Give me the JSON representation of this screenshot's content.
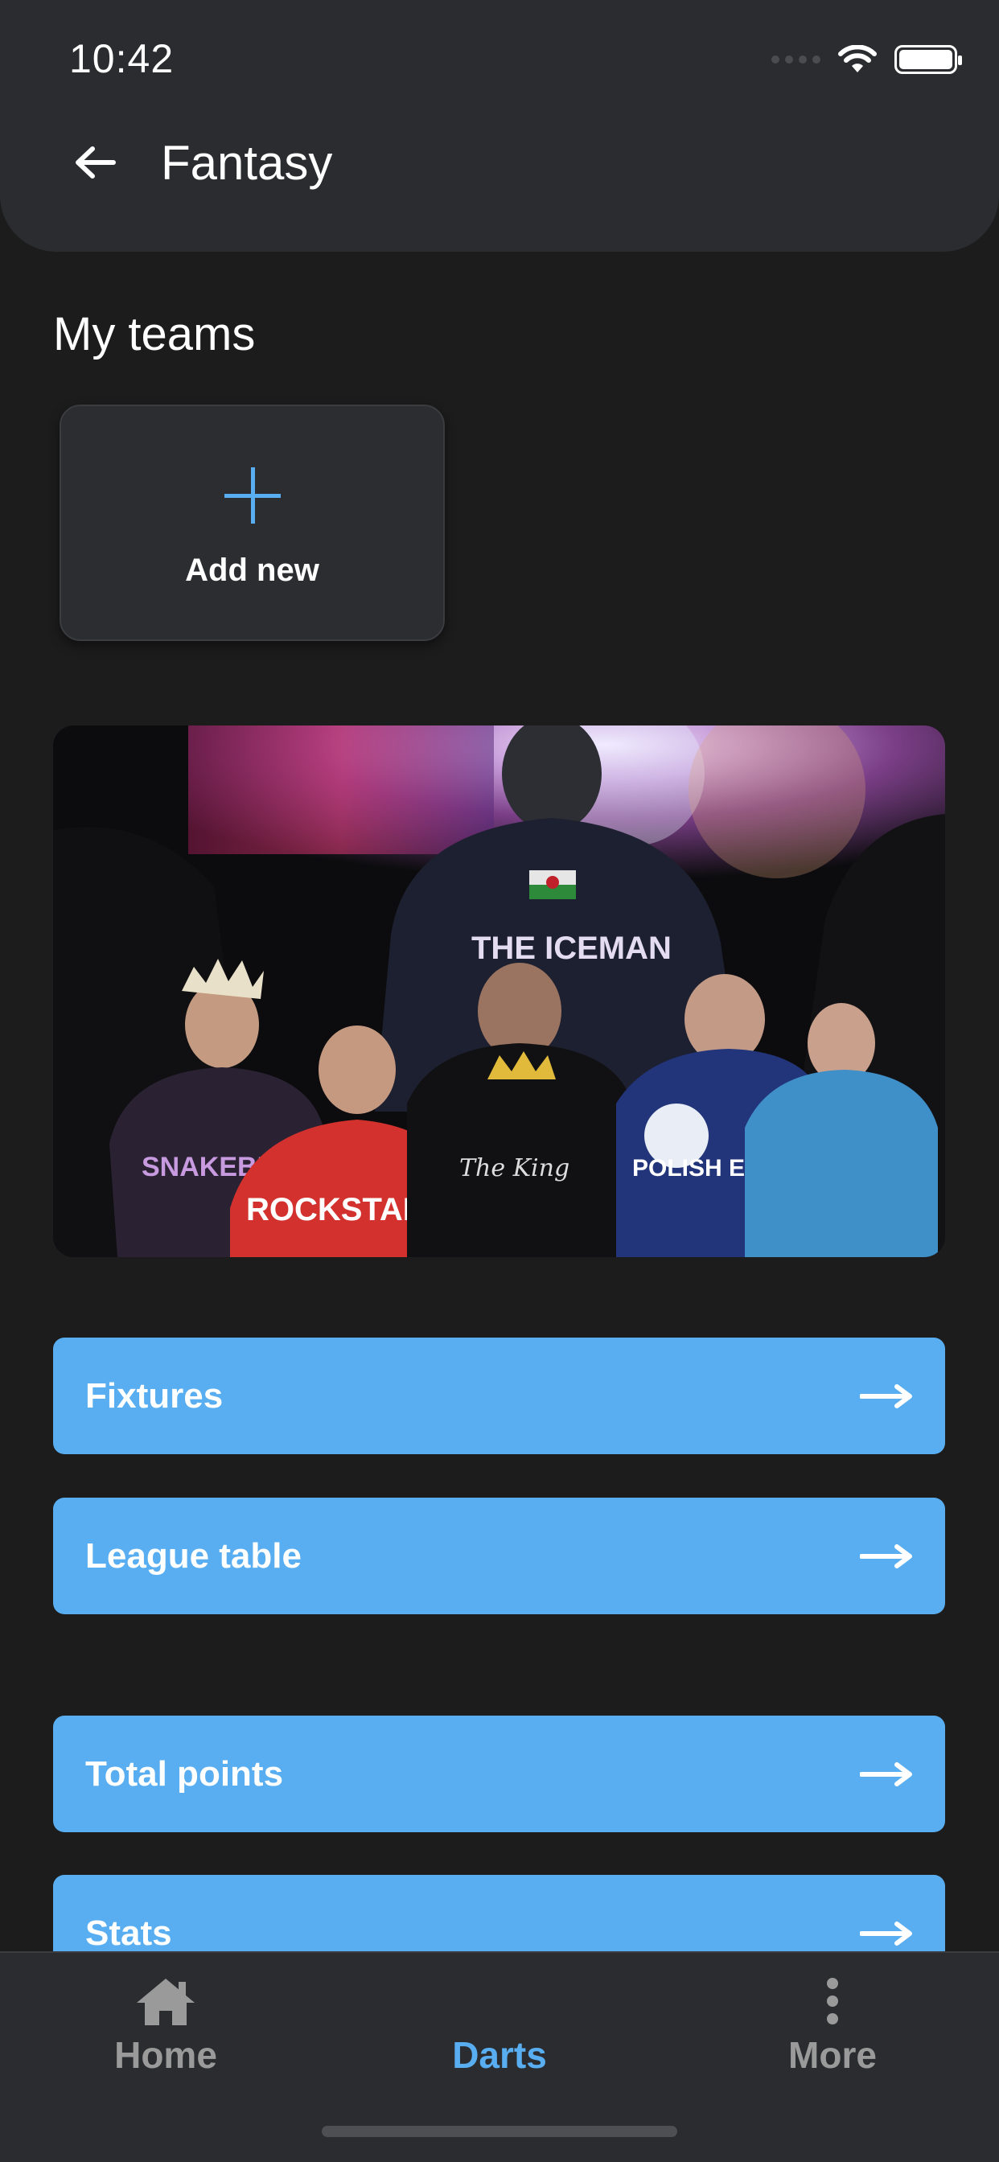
{
  "status_bar": {
    "time": "10:42"
  },
  "header": {
    "title": "Fantasy",
    "back_icon": "arrow-left-icon"
  },
  "my_teams": {
    "title": "My teams",
    "add_card": {
      "label": "Add new",
      "icon": "plus-icon"
    }
  },
  "banner": {
    "alt_text": "Darts players walking out",
    "shirt_text": "THE ICEMAN"
  },
  "menu": [
    {
      "label": "Fixtures",
      "icon": "arrow-right-icon"
    },
    {
      "label": "League table",
      "icon": "arrow-right-icon"
    },
    {
      "label": "Total points",
      "icon": "arrow-right-icon"
    },
    {
      "label": "Stats",
      "icon": "arrow-right-icon"
    }
  ],
  "tabbar": {
    "items": [
      {
        "label": "Home",
        "icon": "house-icon",
        "active": false
      },
      {
        "label": "Darts",
        "icon": "soundwave-icon",
        "active": true
      },
      {
        "label": "More",
        "icon": "vertical-dots-icon",
        "active": false
      }
    ]
  },
  "colors": {
    "accent": "#58aef0",
    "background": "#1c1c1d",
    "surface": "#2a2c2f",
    "inactive_tab": "#9a9a9a"
  }
}
